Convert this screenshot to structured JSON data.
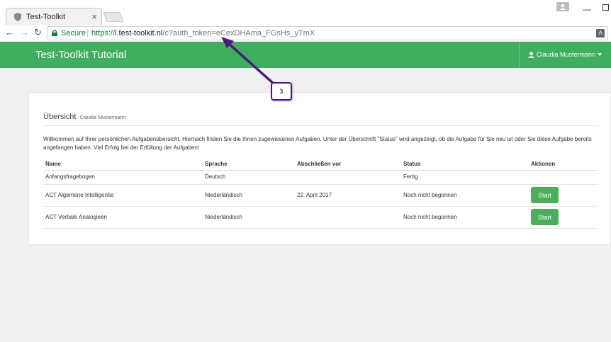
{
  "browser": {
    "tab_title": "Test-Toolkit",
    "tab_close": "×",
    "secure_label": "Secure",
    "url_scheme": "https://",
    "url_host": "l.test-toolkit.nl",
    "url_rest": "/c?auth_token=eCexDHAma_FGsHs_yTmX"
  },
  "navbar": {
    "brand": "Test-Toolkit Tutorial",
    "user_name": "Claudia Mustermann"
  },
  "panel": {
    "title": "Übersicht",
    "subtitle": "Claudia Mustermann",
    "intro": "Willkommen auf Ihrer persönlichen Aufgabenübersicht. Hiernach finden Sie die Ihnen zugewiesenen Aufgaben. Unter der Überschrift \"Status\" wird angezeigt, ob die Aufgabe für Sie neu ist oder Sie diese Aufgabe bereits angefangen haben. Viel Erfolg bei der Erfüllung der Aufgaben!"
  },
  "table": {
    "headers": [
      "Name",
      "Sprache",
      "Abschließen vor",
      "Status",
      "Aktionen"
    ],
    "rows": [
      {
        "name": "Anfangsfragebogen",
        "language": "Deutsch",
        "due": "",
        "status": "Fertig",
        "action": ""
      },
      {
        "name": "ACT Algemene Intelligentie",
        "language": "Niederländisch",
        "due": "22. April 2017",
        "status": "Noch nicht begonnen",
        "action": "Start"
      },
      {
        "name": "ACT Verbale Analogieën",
        "language": "Niederländisch",
        "due": "",
        "status": "Noch nicht begonnen",
        "action": "Start"
      }
    ]
  },
  "annotation": {
    "label": "3",
    "color": "#4a1a7a"
  },
  "colors": {
    "brand_green": "#3fae5e",
    "button_green": "#4cae5c"
  }
}
